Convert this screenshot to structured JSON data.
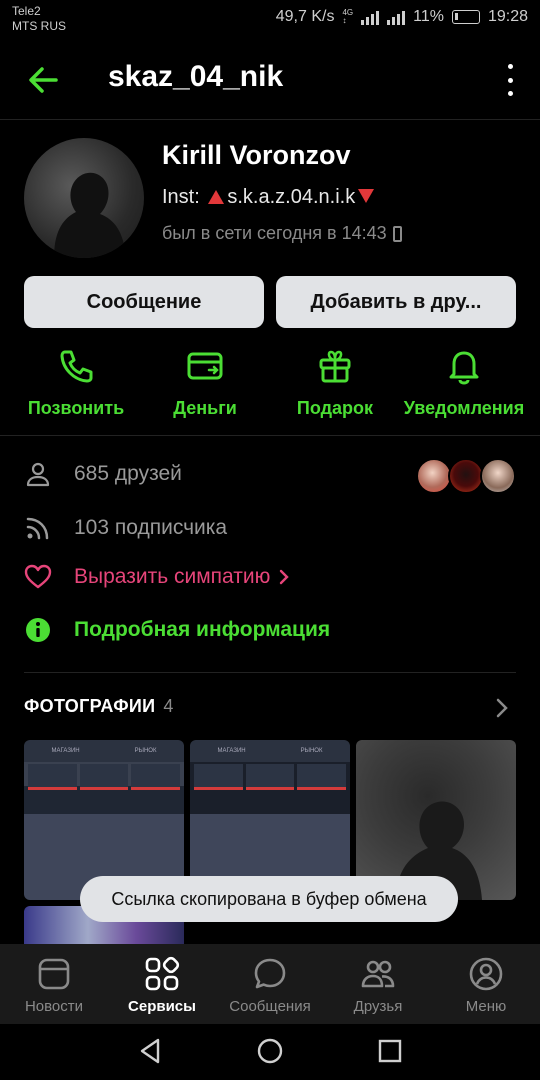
{
  "status_bar": {
    "carrier_1": "Tele2",
    "carrier_2": "MTS RUS",
    "speed": "49,7 K/s",
    "battery": "11%",
    "time": "19:28"
  },
  "header": {
    "username": "skaz_04_nik"
  },
  "profile": {
    "name": "Kirill Voronzov",
    "inst_label": "Inst:",
    "inst_handle": "s.k.a.z.04.n.i.k",
    "last_seen": "был в сети сегодня в 14:43"
  },
  "buttons": {
    "message": "Сообщение",
    "add_friend": "Добавить в дру..."
  },
  "actions": [
    {
      "label": "Позвонить",
      "icon": "phone-icon"
    },
    {
      "label": "Деньги",
      "icon": "money-icon"
    },
    {
      "label": "Подарок",
      "icon": "gift-icon"
    },
    {
      "label": "Уведомления",
      "icon": "bell-icon"
    }
  ],
  "info": {
    "friends": "685 друзей",
    "subscribers": "103 подписчика",
    "like": "Выразить симпатию",
    "details": "Подробная информация"
  },
  "photos": {
    "title": "ФОТОГРАФИИ",
    "count": "4",
    "tile_header_left": "МАГАЗИН",
    "tile_header_right": "РЫНОК"
  },
  "toast": "Ссылка скопирована в буфер обмена",
  "tabs": [
    {
      "label": "Новости",
      "icon": "news-icon"
    },
    {
      "label": "Сервисы",
      "icon": "services-icon"
    },
    {
      "label": "Сообщения",
      "icon": "messages-icon"
    },
    {
      "label": "Друзья",
      "icon": "friends-icon"
    },
    {
      "label": "Меню",
      "icon": "menu-profile-icon"
    }
  ],
  "colors": {
    "accent": "#4bde34",
    "like": "#e6457a",
    "background": "#000000",
    "button": "#e1e3e6"
  }
}
